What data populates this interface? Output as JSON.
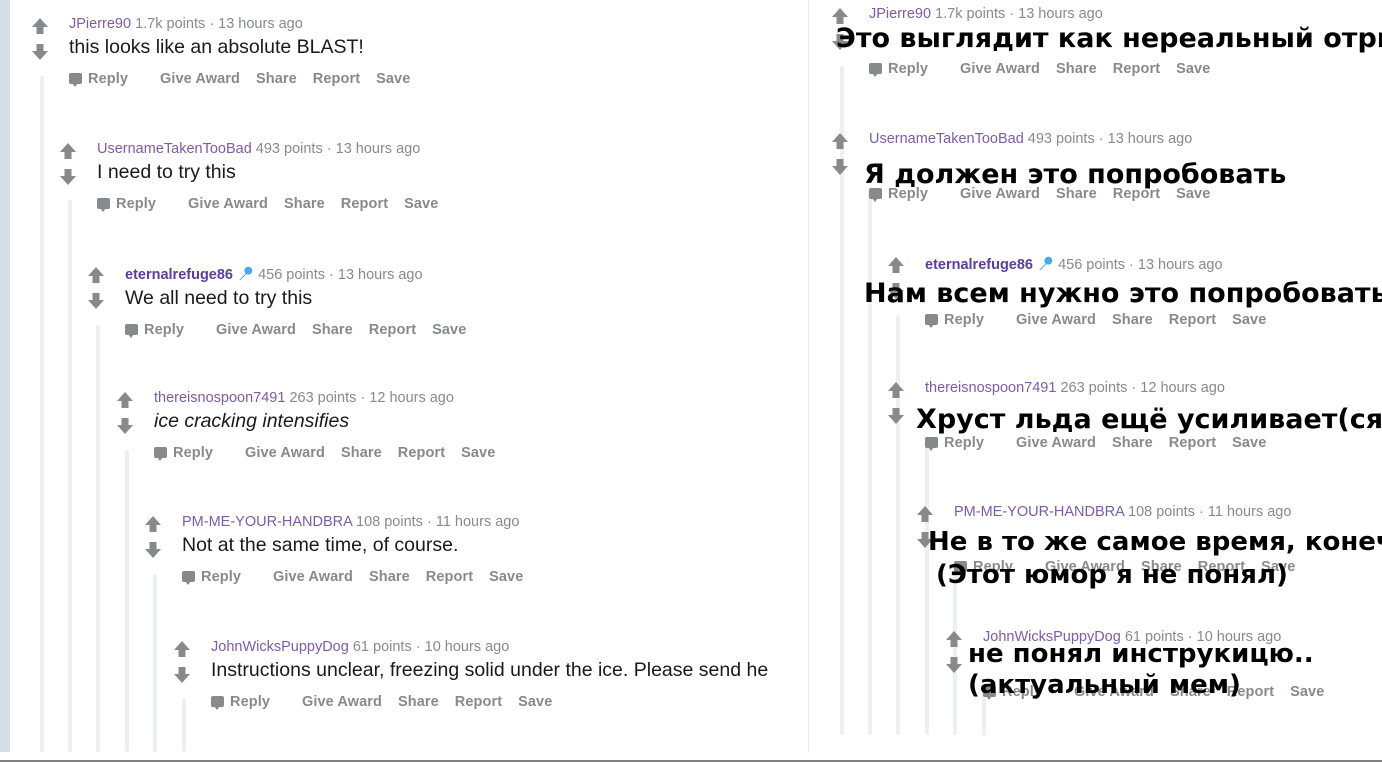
{
  "page": {
    "title": "Reddit comment thread with Russian translation overlay",
    "gutter_color": "#d5dee6",
    "thread_line_color": "#edeff1",
    "author_color": "#7c5ca8",
    "meta_color": "#878a8c",
    "body_color": "#1a1a1b",
    "overlay_color": "#000000"
  },
  "actions": {
    "reply": "Reply",
    "give_award": "Give Award",
    "share": "Share",
    "report": "Report",
    "save": "Save",
    "reply_icon": "speech-bubble-icon",
    "upvote_icon": "arrow-up-icon",
    "downvote_icon": "arrow-down-icon"
  },
  "comments": [
    {
      "id": "c1",
      "author": "JPierre90",
      "points": "1.7k points",
      "separator": "·",
      "age": "13 hours ago",
      "badge": null,
      "body": "this looks like an absolute BLAST!",
      "italic": false,
      "depth": 0
    },
    {
      "id": "c2",
      "author": "UsernameTakenTooBad",
      "points": "493 points",
      "separator": "·",
      "age": "13 hours ago",
      "badge": null,
      "body": "I need to try this",
      "italic": false,
      "depth": 1
    },
    {
      "id": "c3",
      "author": "eternalrefuge86",
      "points": "456 points",
      "separator": "·",
      "age": "13 hours ago",
      "badge": "microphone-emoji",
      "body": "We all need to try this",
      "italic": false,
      "depth": 2
    },
    {
      "id": "c4",
      "author": "thereisnospoon7491",
      "points": "263 points",
      "separator": "·",
      "age": "12 hours ago",
      "badge": null,
      "body": "ice cracking intensifies",
      "italic": true,
      "depth": 3
    },
    {
      "id": "c5",
      "author": "PM-ME-YOUR-HANDBRA",
      "points": "108 points",
      "separator": "·",
      "age": "11 hours ago",
      "badge": null,
      "body": "Not at the same time, of course.",
      "italic": false,
      "depth": 4
    },
    {
      "id": "c6",
      "author": "JohnWicksPuppyDog",
      "points": "61 points",
      "separator": "·",
      "age": "10 hours ago",
      "badge": null,
      "body": "Instructions unclear, freezing solid under the ice. Please send he",
      "italic": false,
      "depth": 5
    }
  ],
  "translations": [
    {
      "id": "t1",
      "for": "c1",
      "lines": [
        "Это выглядит как нереальный отрыв"
      ]
    },
    {
      "id": "t2",
      "for": "c2",
      "lines": [
        "Я должен это попробовать"
      ]
    },
    {
      "id": "t3",
      "for": "c3",
      "lines": [
        "Нам всем нужно это попробовать"
      ]
    },
    {
      "id": "t4",
      "for": "c4",
      "lines": [
        "Хруст льда ещё усиливает(ся)"
      ]
    },
    {
      "id": "t5",
      "for": "c5",
      "lines": [
        "Не в то же самое время, конечно",
        "(Этот юмор я не понял)"
      ]
    },
    {
      "id": "t6",
      "for": "c6",
      "lines": [
        "не понял инструкицю..",
        "(актуальный мем)"
      ]
    }
  ],
  "translation_text": {
    "t1_l1": "Это выглядит как нереальный отрыв",
    "t2_l1": "Я должен это попробовать",
    "t3_l1": "Нам всем нужно это попробовать",
    "t4_l1": "Хруст льда ещё усиливает(ся)",
    "t5_l1": "Не в то же самое время, конечно",
    "t5_l2": "(Этот юмор я не понял)",
    "t6_l1": "не понял инструкицю..",
    "t6_l2": "(актуальный мем)"
  }
}
